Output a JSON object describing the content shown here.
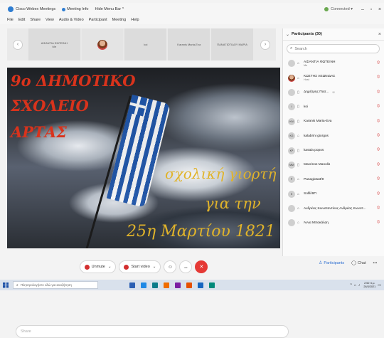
{
  "titlebar": {
    "app_name": "Cisco Webex Meetings",
    "meeting_info": "Meeting Info",
    "hide_menu": "Hide Menu Bar ^",
    "connected": "Connected ▾",
    "controls": [
      "–",
      "▫",
      "×"
    ]
  },
  "menubar": [
    "File",
    "Edit",
    "Share",
    "View",
    "Audio & Video",
    "Participant",
    "Meeting",
    "Help"
  ],
  "strip": {
    "prev": "‹",
    "next": "›",
    "tiles": [
      {
        "label": "ΑΙΣΑΝΤΙΑ ΦΩΤΕΙΝΗ",
        "sub": "Me",
        "width": 74,
        "type": "name"
      },
      {
        "label": "",
        "sub": "",
        "width": 60,
        "type": "avatar"
      },
      {
        "label": "koi",
        "sub": "",
        "width": 60,
        "type": "name"
      },
      {
        "label": "Karanis Maria-Eva",
        "sub": "",
        "width": 60,
        "type": "name"
      },
      {
        "label": "ΠΑΝΑΓΙΩΤΙΔΟΥ ΜΑΡΙΑ",
        "sub": "",
        "width": 60,
        "type": "name"
      }
    ]
  },
  "slide": {
    "school_lines": [
      "9ο ΔΗΜΟΤΙΚΟ",
      "ΣΧΟΛΕΙΟ",
      "ΑΡΤΑΣ"
    ],
    "event_lines": [
      "σχολική γιορτή",
      "για την",
      "25η Μαρτίου 1821"
    ]
  },
  "participants": {
    "title": "Participants (30)",
    "search_placeholder": "Search",
    "items": [
      {
        "name": "ΑΙΣΑΝΤΙΑ ΦΩΤΕΙΝΗ",
        "sub": "Me",
        "initials": "",
        "photo": false,
        "icon": "⌂"
      },
      {
        "name": "ΚΩΣΤΗΣ ΛΕΩΝΙΔΑΣ",
        "sub": "Host",
        "initials": "",
        "photo": true,
        "icon": "⌂"
      },
      {
        "name": "Δημήτρης Πασ...",
        "sub": "",
        "initials": "",
        "photo": false,
        "icon": "▯",
        "extra": "☺"
      },
      {
        "name": "koi",
        "sub": "",
        "initials": "I",
        "photo": false,
        "icon": "▯"
      },
      {
        "name": "Karanis Maria-Eva",
        "sub": "",
        "initials": "KM",
        "photo": false,
        "icon": "▯"
      },
      {
        "name": "kalabrini giorgos",
        "sub": "",
        "initials": "KG",
        "photo": false,
        "icon": "⌂"
      },
      {
        "name": "kasala popos",
        "sub": "",
        "initials": "KP",
        "photo": false,
        "icon": "▯"
      },
      {
        "name": "Mavrinos Manolis",
        "sub": "",
        "initials": "MM",
        "photo": false,
        "icon": "▯"
      },
      {
        "name": "Panagiota3/9",
        "sub": "",
        "initials": "P",
        "photo": false,
        "icon": "⌂"
      },
      {
        "name": "Sofili/9Π",
        "sub": "",
        "initials": "S",
        "photo": false,
        "icon": "⌂"
      },
      {
        "name": "Ανδρέας Κωνσταντίνος Ανδρέας Κωνστ...",
        "sub": "",
        "initials": "",
        "photo": false,
        "icon": "⌂"
      },
      {
        "name": "Άννα Μπακάλαη",
        "sub": "",
        "initials": "",
        "photo": false,
        "icon": "⌂"
      }
    ]
  },
  "controls": {
    "unmute": "Unmute",
    "start_video": "Start video",
    "share": "Share",
    "participants_btn": "Participants",
    "chat_btn": "Chat",
    "chevron": "⌄",
    "more": "•••",
    "end": "✕"
  },
  "taskbar": {
    "search_placeholder": "Πληκτρολογήστε εδώ για αναζήτηση",
    "time": "2:52 π.μ.",
    "date": "26/3/2021",
    "app_colors": [
      "#2b5fb3",
      "#1e88e5",
      "#0a7a8a",
      "#ef6c00",
      "#7b1fa2",
      "#e65100",
      "#1565c0",
      "#00897b"
    ]
  }
}
